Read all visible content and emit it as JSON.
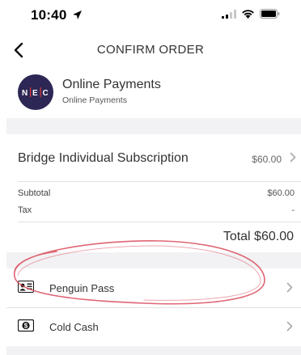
{
  "status_bar": {
    "time": "10:40"
  },
  "nav": {
    "title": "CONFIRM ORDER"
  },
  "merchant": {
    "logo_letters": [
      "N",
      "E",
      "C"
    ],
    "name": "Online Payments",
    "subtitle": "Online Payments",
    "logo_color": "#2c2755"
  },
  "order": {
    "item_name": "Bridge Individual Subscription",
    "item_price": "$60.00",
    "subtotal_label": "Subtotal",
    "subtotal_value": "$60.00",
    "tax_label": "Tax",
    "tax_value": "-",
    "total": "Total $60.00"
  },
  "payment_methods": [
    {
      "label": "Penguin Pass",
      "icon": "id-card-icon"
    },
    {
      "label": "Cold Cash",
      "icon": "cash-icon"
    }
  ],
  "colors": {
    "background": "#ffffff",
    "band": "#f2f2f4",
    "annotation": "#d94a5a",
    "text": "#333333"
  }
}
